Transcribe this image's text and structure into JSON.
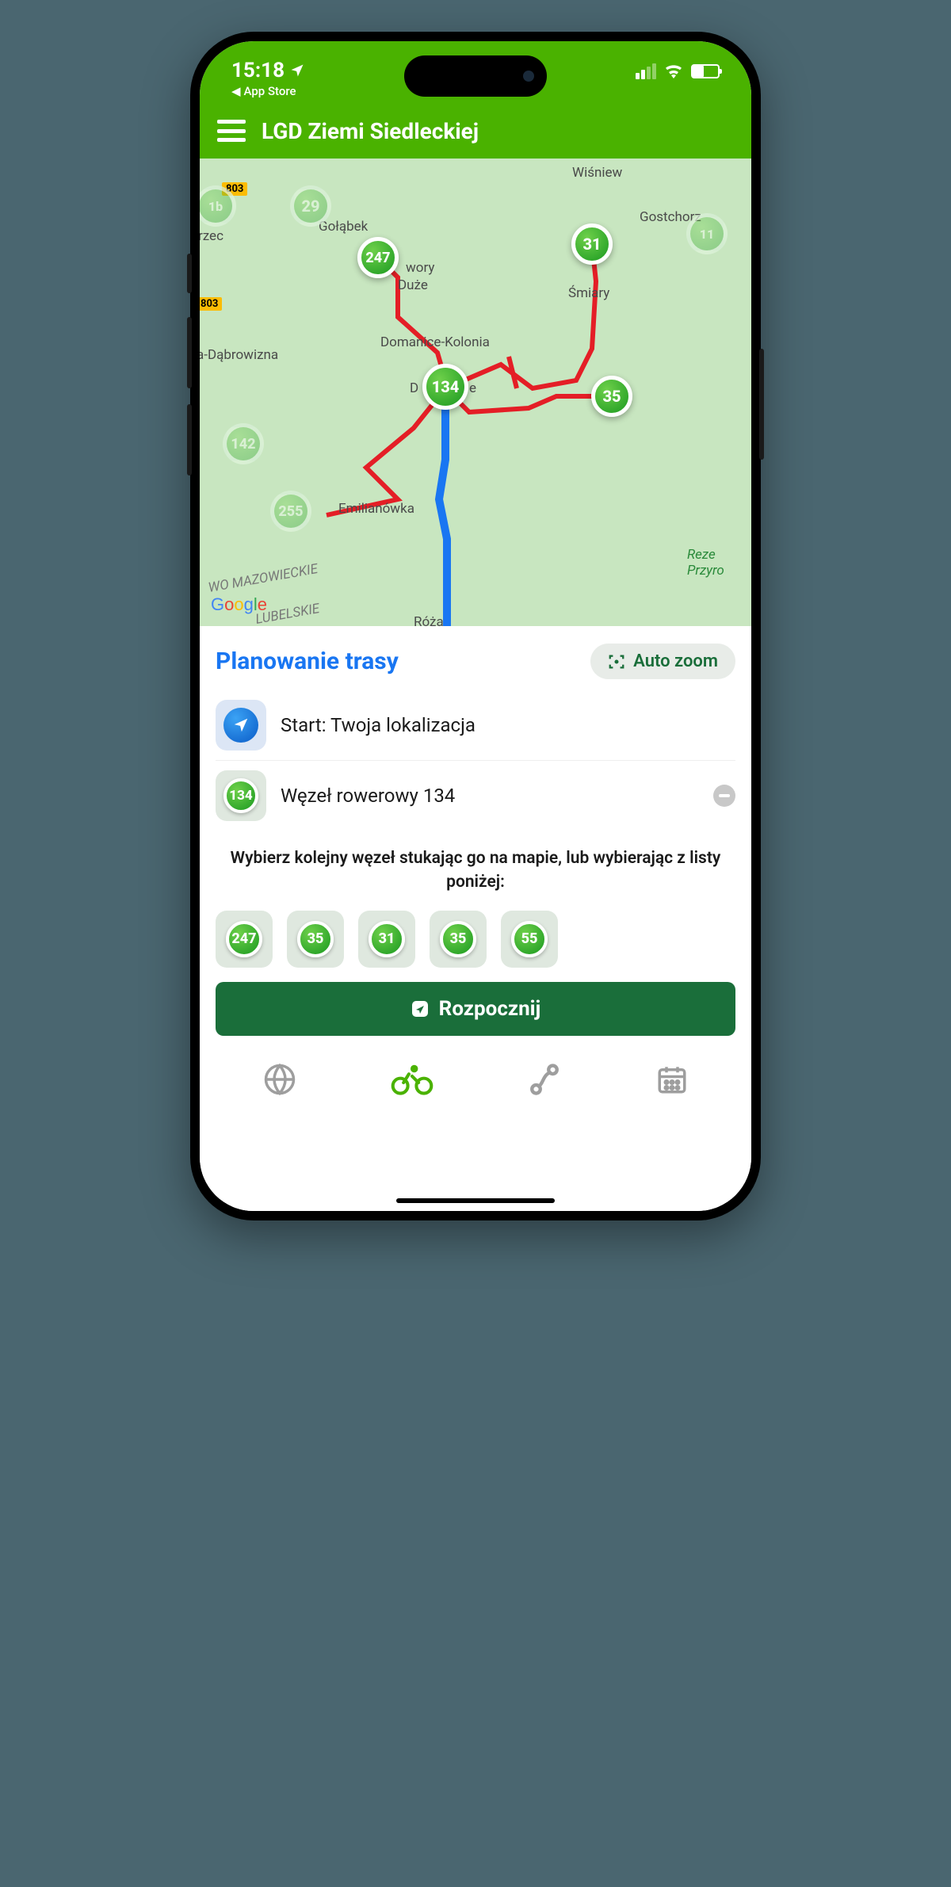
{
  "status": {
    "time": "15:18",
    "back_label": "App Store"
  },
  "header": {
    "title": "LGD Ziemi Siedleckiej"
  },
  "map": {
    "labels": {
      "wisniew": "Wiśniew",
      "gostchorz": "Gostchorz",
      "golabek": "Gołąbek",
      "rzec": "rzec",
      "wory": "wory",
      "duze": "Duże",
      "smiary": "Śmiary",
      "domanice_kolonia": "Domanice-Kolonia",
      "dabrowizna": "a-Dąbrowizna",
      "domanice_prefix": "D",
      "domanice_suffix": "e",
      "emilianowka": "Emilianówka",
      "roza": "Róża",
      "mazowieckie": "WO MAZOWIECKIE",
      "lubelskie": "LUBELSKIE",
      "rezerwat1": "Reze",
      "rezerwat2": "Przyro",
      "road803a": "803",
      "road803b": "803"
    },
    "nodes": {
      "n247": "247",
      "n31": "31",
      "n134": "134",
      "n35": "35",
      "n142": "142",
      "n29": "29",
      "n255": "255",
      "n1b": "1b",
      "n_right": "11"
    }
  },
  "panel": {
    "title": "Planowanie trasy",
    "auto_zoom": "Auto zoom",
    "start_label": "Start: Twoja lokalizacja",
    "node_row_label": "Węzeł rowerowy 134",
    "node_row_badge": "134",
    "hint": "Wybierz kolejny węzeł stukając go na mapie, lub wybierając z listy poniżej:",
    "suggestions": [
      "247",
      "35",
      "31",
      "35",
      "55"
    ],
    "start_button": "Rozpocznij"
  }
}
